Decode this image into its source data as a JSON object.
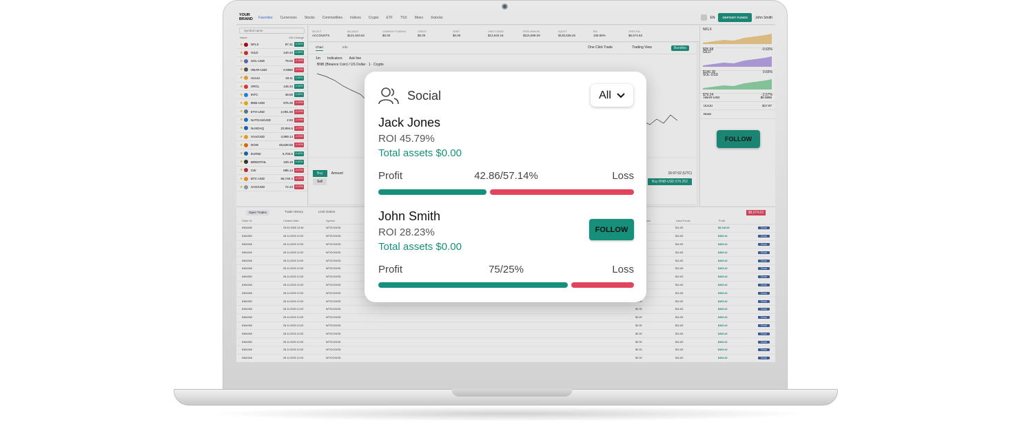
{
  "brand": "YOUR BRAND",
  "nav": [
    "Favorites",
    "Currencies",
    "Stocks",
    "Commodities",
    "Indices",
    "Crypto",
    "ETF",
    "TSX",
    "Moex",
    "Xstocks"
  ],
  "topbar": {
    "lang": "EN",
    "deposit": "DEPOSIT FUNDS",
    "user": "John Smith"
  },
  "sidebar": {
    "search_placeholder": "Symbol name",
    "col_name": "Name",
    "col_change": "24h Change",
    "symbols": [
      {
        "name": "NFLX",
        "price": "97.41",
        "chg": "0.00%",
        "dir": "up",
        "color": "#b00020"
      },
      {
        "name": "GILD",
        "price": "140.43",
        "chg": "0.00%",
        "dir": "up",
        "color": "#d32f2f"
      },
      {
        "name": "SOL-USD",
        "price": "79.02",
        "chg": "-2.00%",
        "dir": "dn",
        "color": "#5c6bc0"
      },
      {
        "name": "HBAR-USD",
        "price": "0.0860",
        "chg": "-3.00%",
        "dir": "dn",
        "color": "#555"
      },
      {
        "name": "UUUU",
        "price": "18.11",
        "chg": "0.00%",
        "dir": "up",
        "color": "#f9a825"
      },
      {
        "name": "ORCL",
        "price": "145.34",
        "chg": "0.00%",
        "dir": "up",
        "color": "#e53935"
      },
      {
        "name": "INTC",
        "price": "48.69",
        "chg": "0.00%",
        "dir": "up",
        "color": "#1e88e5"
      },
      {
        "name": "BNB-USD",
        "price": "575.25",
        "chg": "-1.00%",
        "dir": "dn",
        "color": "#f0b90b"
      },
      {
        "name": "ETH-USD",
        "price": "2,091.68",
        "chg": "-2.00%",
        "dir": "dn",
        "color": "#607d8b"
      },
      {
        "name": "NATGAS/USD",
        "price": "2.93",
        "chg": "-1.00%",
        "dir": "dn",
        "color": "#1976d2"
      },
      {
        "name": "NASDAQ",
        "price": "23,994.6",
        "chg": "-1.00%",
        "dir": "dn",
        "color": "#1565c0"
      },
      {
        "name": "XAU/USD",
        "price": "4,959.14",
        "chg": "-1.00%",
        "dir": "dn",
        "color": "#f9a825"
      },
      {
        "name": "DOW",
        "price": "48,528.55",
        "chg": "-1.00%",
        "dir": "dn",
        "color": "#ef6c00"
      },
      {
        "name": "EUR50",
        "price": "5,703.6",
        "chg": "0.00%",
        "dir": "up",
        "color": "#1565c0"
      },
      {
        "name": "BRENTOIL",
        "price": "109.19",
        "chg": "0.00%",
        "dir": "up",
        "color": "#333"
      },
      {
        "name": "CW",
        "price": "685.14",
        "chg": "-3.00%",
        "dir": "dn",
        "color": "#c62828"
      },
      {
        "name": "BTC-USD",
        "price": "66,740.4",
        "chg": "-1.00%",
        "dir": "dn",
        "color": "#f7931a"
      },
      {
        "name": "XAG/USD",
        "price": "72.43",
        "chg": "-3.00%",
        "dir": "dn",
        "color": "#90a4ae"
      }
    ]
  },
  "account": [
    {
      "label": "SELECT",
      "value": "ACCOUNTS"
    },
    {
      "label": "BALANCE",
      "value": "$121,943.62"
    },
    {
      "label": "COMPANY FUNDING",
      "value": "$0.00"
    },
    {
      "label": "CREDIT",
      "value": "$0.00"
    },
    {
      "label": "DEBIT",
      "value": "$0.00"
    },
    {
      "label": "USED FUNDS",
      "value": "$13,940.16"
    },
    {
      "label": "FREE MARGIN",
      "value": "$116,598.09"
    },
    {
      "label": "EQUITY",
      "value": "$130,538.25"
    },
    {
      "label": "ROI",
      "value": "108.68%"
    },
    {
      "label": "OPEN P&L",
      "value": "$8,574.63"
    }
  ],
  "chart": {
    "tab_chart": "Chart",
    "tab_info": "Info",
    "title": "BNB (Binance Coin) / US Dollar · 1 · Crypto",
    "toggle1": "One Click Trade",
    "toggle2": "Trading View",
    "bundles": "Bundles",
    "interval": "1m",
    "indicators": "Indicators",
    "ask": "Ask line",
    "buy": "Buy",
    "sell": "Sell",
    "amount": "Amount",
    "buy_big": "Buy BNB-USD",
    "buy_big_price": "575.252",
    "time": "15:07:02 (UTC)"
  },
  "right_panel": {
    "items": [
      {
        "name": "NFLX",
        "price": "$95.68",
        "chg": "-0.63%"
      },
      {
        "name": "GILD",
        "price": "$140.28",
        "chg": "0.65%"
      },
      {
        "name": "SOL-USD",
        "price": "$79.24",
        "chg": "-2.57%"
      }
    ],
    "hbar": "HBAR-USD",
    "hbar_price": "$0.0865",
    "uuuu": "UUUU",
    "uuuu_price": "$17.97",
    "news": "News",
    "follow": "FOLLOW"
  },
  "trades": {
    "tabs": [
      "Open Trades",
      "Trade History",
      "Limit Orders"
    ],
    "open_pl": "$8,574.63",
    "headers": [
      "Order ID",
      "Created Date",
      "Symbol",
      "",
      "",
      "",
      "",
      "",
      "",
      "",
      "Commission",
      "Used Funds",
      "Profit"
    ],
    "rows": [
      {
        "id": "6364456",
        "date": "25.03.2026 12:45",
        "sym": "WTICO/USD",
        "comm": "$0.00",
        "used": "$11.83",
        "profit": "$8,118.00"
      },
      {
        "id": "6364350",
        "date": "28.11.2025 12:03",
        "sym": "WTICO/USD",
        "comm": "$0.30",
        "used": "$11.83",
        "profit": "$463.42"
      },
      {
        "id": "6364348",
        "date": "28.11.2025 12:03",
        "sym": "WTICO/USD",
        "comm": "$0.30",
        "used": "$11.83",
        "profit": "$463.42"
      },
      {
        "id": "6364349",
        "date": "28.11.2025 12:03",
        "sym": "WTICO/USD",
        "comm": "$0.30",
        "used": "$11.83",
        "profit": "$463.42"
      },
      {
        "id": "6364348",
        "date": "28.11.2025 12:09",
        "sym": "WTICO/USD",
        "comm": "$0.30",
        "used": "$11.83",
        "profit": "$463.42"
      },
      {
        "id": "6364348",
        "date": "28.11.2025 12:03",
        "sym": "WTICO/USD",
        "comm": "$0.30",
        "used": "$11.83",
        "profit": "$463.42"
      },
      {
        "id": "6364350",
        "date": "28.11.2025 12:03",
        "sym": "WTICO/USD",
        "comm": "$0.30",
        "used": "$11.83",
        "profit": "$463.42"
      },
      {
        "id": "6364348",
        "date": "28.11.2025 12:03",
        "sym": "WTICO/USD",
        "comm": "$0.30",
        "used": "$11.83",
        "profit": "$463.42"
      },
      {
        "id": "6364348",
        "date": "28.11.2025 12:03",
        "sym": "WTICO/USD",
        "comm": "$0.30",
        "used": "$11.83",
        "profit": "$463.42"
      },
      {
        "id": "6364350",
        "date": "28.11.2025 12:03",
        "sym": "WTICO/USD",
        "comm": "$0.30",
        "used": "$11.83",
        "profit": "$463.42"
      },
      {
        "id": "6364348",
        "date": "28.11.2025 12:03",
        "sym": "WTICO/USD",
        "comm": "$0.30",
        "used": "$11.83",
        "profit": "$463.42"
      },
      {
        "id": "6364348",
        "date": "28.11.2025 12:09",
        "sym": "WTICO/USD",
        "comm": "$0.30",
        "used": "$11.83",
        "profit": "$463.42"
      },
      {
        "id": "6364348",
        "date": "28.11.2025 12:03",
        "sym": "WTICO/USD",
        "comm": "$0.30",
        "used": "$11.83",
        "profit": "$463.42"
      },
      {
        "id": "6364348",
        "date": "28.11.2025 12:03",
        "sym": "WTICO/USD",
        "comm": "$0.30",
        "used": "$11.83",
        "profit": "$463.42"
      },
      {
        "id": "6364350",
        "date": "28.11.2025 12:03",
        "sym": "WTICO/USD",
        "comm": "$0.30",
        "used": "$11.83",
        "profit": "$463.42"
      },
      {
        "id": "6364348",
        "date": "28.11.2025 12:03",
        "sym": "WTICO/USD",
        "comm": "$0.30",
        "used": "$11.83",
        "profit": "$463.42"
      },
      {
        "id": "6364348",
        "date": "28.11.2025 12:03",
        "sym": "WTICO/USD",
        "comm": "$0.30",
        "used": "$11.83",
        "profit": "$463.42"
      }
    ],
    "close_label": "Close"
  },
  "social": {
    "title": "Social",
    "filter": "All",
    "traders": [
      {
        "name": "Jack Jones",
        "roi": "ROI 45.79%",
        "assets": "Total assets $0.00",
        "profit_label": "Profit",
        "ratio": "42.86/57.14%",
        "loss_label": "Loss",
        "profit_frac": 0.4286
      },
      {
        "name": "John Smith",
        "roi": "ROI 28.23%",
        "assets": "Total assets $0.00",
        "profit_label": "Profit",
        "ratio": "75/25%",
        "loss_label": "Loss",
        "profit_frac": 0.75,
        "follow": "FOLLOW"
      }
    ]
  }
}
